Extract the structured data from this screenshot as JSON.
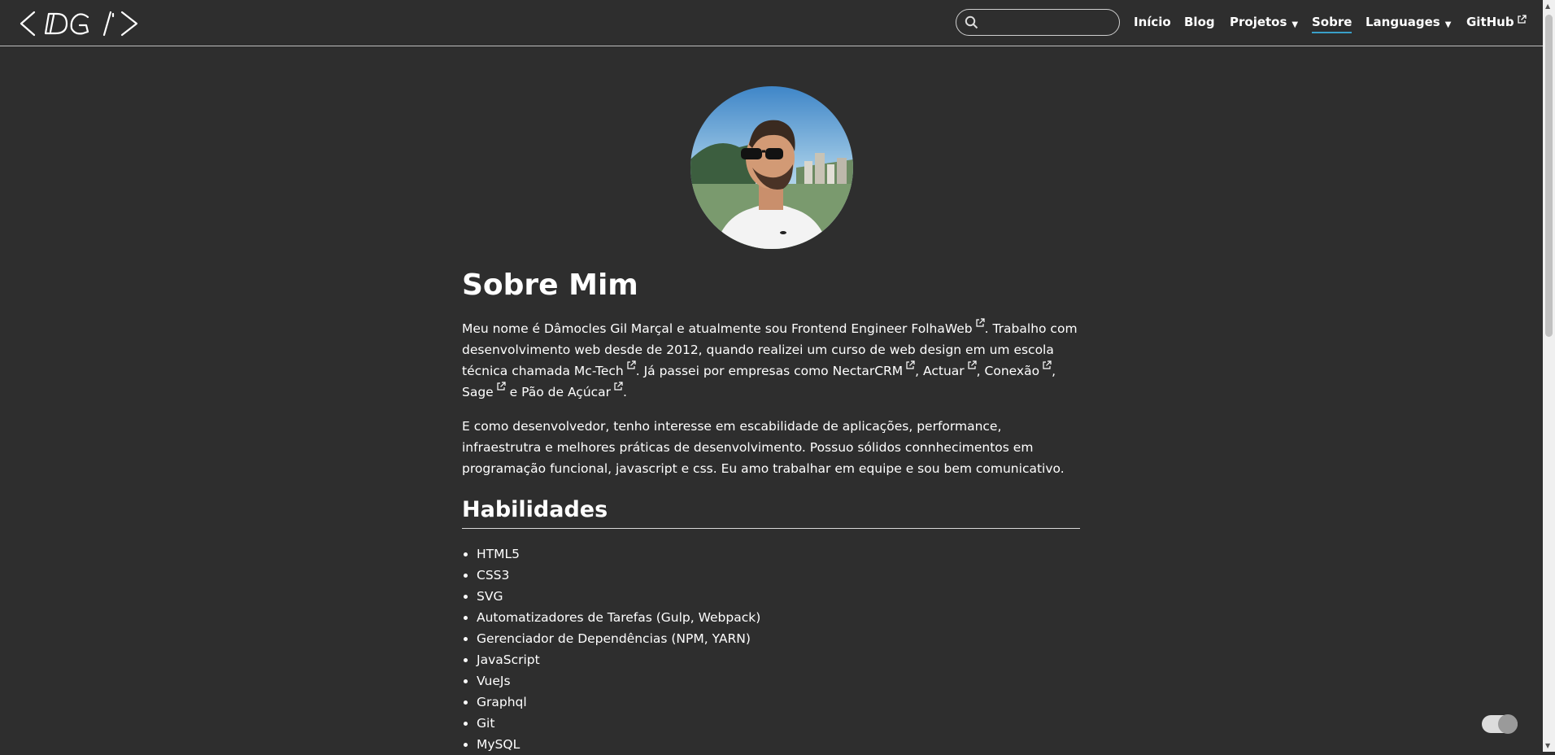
{
  "header": {
    "logo_text": "< DG />",
    "search": {
      "placeholder": "",
      "value": ""
    },
    "nav": {
      "inicio": "Início",
      "blog": "Blog",
      "projetos": "Projetos",
      "sobre": "Sobre",
      "languages": "Languages",
      "github": "GitHub"
    },
    "active_item": "Sobre",
    "accent_color": "#3aa0c9"
  },
  "main": {
    "title": "Sobre Mim",
    "intro": {
      "t1": "Meu nome é Dâmocles Gil Marçal e atualmente sou Frontend Engineer ",
      "l1": "FolhaWeb",
      "t2": ". Trabalho com desenvolvimento web desde de 2012, quando realizei um curso de web design em um escola técnica chamada ",
      "l2": "Mc-Tech",
      "t3": ". Já passei por empresas como ",
      "l3": "NectarCRM",
      "t4": ", ",
      "l4": "Actuar",
      "t5": ", ",
      "l5": "Conexão",
      "t6": ", ",
      "l6": "Sage",
      "t7": " e ",
      "l7": "Pão de Açúcar",
      "t8": "."
    },
    "paragraph2": "E como desenvolvedor, tenho interesse em escabilidade de aplicações, performance, infraestrutra e melhores práticas de desenvolvimento. Possuo sólidos connhecimentos em programação funcional, javascript e css. Eu amo trabalhar em equipe e sou bem comunicativo.",
    "skills_heading": "Habilidades",
    "skills": [
      "HTML5",
      "CSS3",
      "SVG",
      "Automatizadores de Tarefas (Gulp, Webpack)",
      "Gerenciador de Dependências (NPM, YARN)",
      "JavaScript",
      "VueJs",
      "Graphql",
      "Git",
      "MySQL"
    ]
  },
  "theme_toggle": {
    "state": "on"
  },
  "colors": {
    "background": "#2e2e2e",
    "text": "#ffffff",
    "link_underline": "#3aa0c9"
  }
}
